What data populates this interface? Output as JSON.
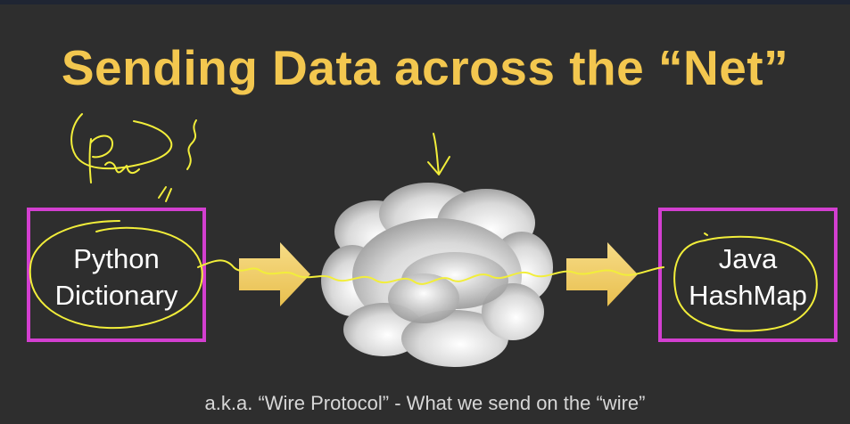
{
  "slide": {
    "title": "Sending Data across the “Net”",
    "left_box": {
      "line1": "Python",
      "line2": "Dictionary"
    },
    "right_box": {
      "line1": "Java",
      "line2": "HashMap"
    },
    "footer": "a.k.a.  “Wire Protocol” - What we send on the “wire”"
  },
  "colors": {
    "background": "#2e2e2e",
    "title": "#f3c74f",
    "box_border": "#d33fd0",
    "arrow": "#f5d67a",
    "annotation_ink": "#f2ee3a"
  },
  "icons": {
    "arrows": [
      "right-arrow-icon",
      "right-arrow-icon"
    ],
    "cloud": "cloud-icon"
  }
}
